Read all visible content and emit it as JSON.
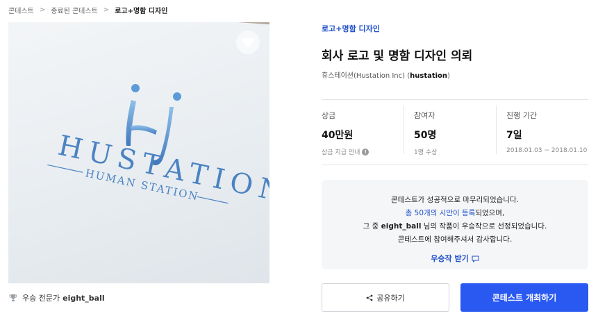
{
  "breadcrumb": {
    "items": [
      "콘테스트",
      "종료된 콘테스트",
      "로고+명함 디자인"
    ]
  },
  "image": {
    "logo_text": "HUSTATION",
    "logo_subtext": "HUMAN STATION",
    "logo_color": "#4b83c2"
  },
  "winner": {
    "prefix": "우승 전문가",
    "nickname": "eight_ball",
    "icon": "trophy-icon"
  },
  "contest": {
    "category": "로고+명함 디자인",
    "title": "회사 로고 및 명함 디자인 의뢰",
    "company": "휴스테이션(Hustation Inc) (",
    "handle": "hustation",
    "company_close": ")"
  },
  "stats": {
    "prize": {
      "label": "상금",
      "value": "40만원",
      "sub": "상금 지급 안내",
      "icon": "info-icon"
    },
    "participants": {
      "label": "참여자",
      "value": "50명",
      "sub": "1명 수상"
    },
    "period": {
      "label": "진행 기간",
      "value": "7일",
      "sub": "2018.01.03 ~ 2018.01.10"
    }
  },
  "notice": {
    "line1": "콘테스트가 성공적으로 마무리되었습니다.",
    "line2_link": "총 50개의 시안이 등록",
    "line2_rest": "되었으며,",
    "line3_pre": "그 중 ",
    "line3_name": "eight_ball",
    "line3_rest": " 님의 작품이 우승작으로 선정되었습니다.",
    "line4": "콘테스트에 참여해주셔서 감사합니다.",
    "award_link": "우승작 받기"
  },
  "buttons": {
    "share": "공유하기",
    "host": "콘테스트 개최하기"
  },
  "colors": {
    "accent": "#2a59f2",
    "link": "#1f4fc9"
  }
}
